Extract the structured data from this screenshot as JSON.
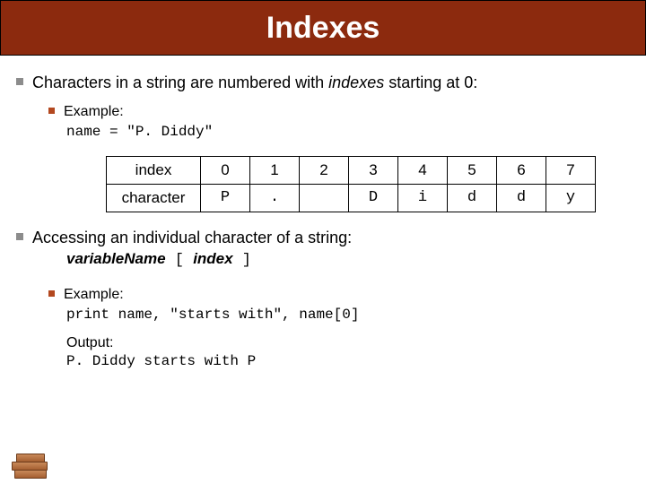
{
  "title": "Indexes",
  "bullets": {
    "b1": "Characters in a string are numbered with ",
    "b1_italic": "indexes",
    "b1_tail": " starting at 0:",
    "b1a_label": "Example:",
    "b1a_code": "name = \"P. Diddy\"",
    "b2": "Accessing an individual character of a string:",
    "b2_syntax_var": "variableName",
    "b2_syntax_lb": " [ ",
    "b2_syntax_idx": "index",
    "b2_syntax_rb": " ]",
    "b2a_label": "Example:",
    "b2a_code": "print name, \"starts with\", name[0]",
    "b2a_out_label": "Output:",
    "b2a_out": "P. Diddy starts with P"
  },
  "table": {
    "row_hdr_index": "index",
    "row_hdr_char": "character",
    "idx": [
      "0",
      "1",
      "2",
      "3",
      "4",
      "5",
      "6",
      "7"
    ],
    "chr": [
      "P",
      ".",
      " ",
      "D",
      "i",
      "d",
      "d",
      "y"
    ]
  }
}
